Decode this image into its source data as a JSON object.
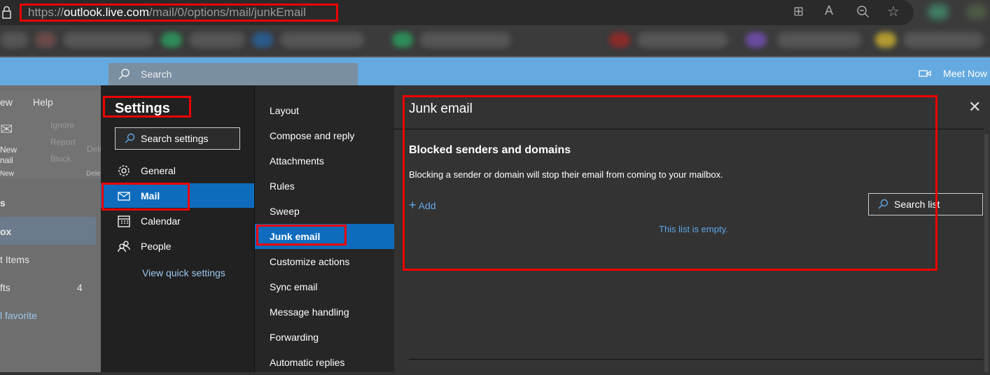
{
  "browser": {
    "url_prefix": "https://",
    "url_host": "outlook.live.com",
    "url_path": "/mail/0/options/mail/junkEmail"
  },
  "header": {
    "search_placeholder": "Search",
    "meet_now": "Meet Now"
  },
  "outlook_bg": {
    "menu": [
      "ew",
      "Help"
    ],
    "ribbon": {
      "new_mail": [
        "New",
        "nail"
      ],
      "new_group": "New",
      "ignore": "Ignore",
      "report": "Report",
      "block": "Block",
      "delete": "Dele",
      "delete_group": "Dele"
    },
    "folders": [
      {
        "label": "s"
      },
      {
        "label": "ox"
      },
      {
        "label": "t Items"
      },
      {
        "label": "fts",
        "count": "4"
      },
      {
        "label": "l favorite"
      }
    ]
  },
  "settings": {
    "title": "Settings",
    "search_placeholder": "Search settings",
    "nav": [
      {
        "label": "General",
        "icon": "gear-icon"
      },
      {
        "label": "Mail",
        "icon": "mail-icon"
      },
      {
        "label": "Calendar",
        "icon": "calendar-icon"
      },
      {
        "label": "People",
        "icon": "people-icon"
      }
    ],
    "quick_link": "View quick settings"
  },
  "mail_sections": [
    "Layout",
    "Compose and reply",
    "Attachments",
    "Rules",
    "Sweep",
    "Junk email",
    "Customize actions",
    "Sync email",
    "Message handling",
    "Forwarding",
    "Automatic replies"
  ],
  "junk": {
    "title": "Junk email",
    "section_title": "Blocked senders and domains",
    "description": "Blocking a sender or domain will stop their email from coming to your mailbox.",
    "add_label": "Add",
    "search_placeholder": "Search list",
    "empty_text": "This list is empty."
  },
  "colors": {
    "accent": "#0f6cbd",
    "link": "#5ea6e6",
    "header": "#64a9e0",
    "annotation": "#ee0000"
  }
}
